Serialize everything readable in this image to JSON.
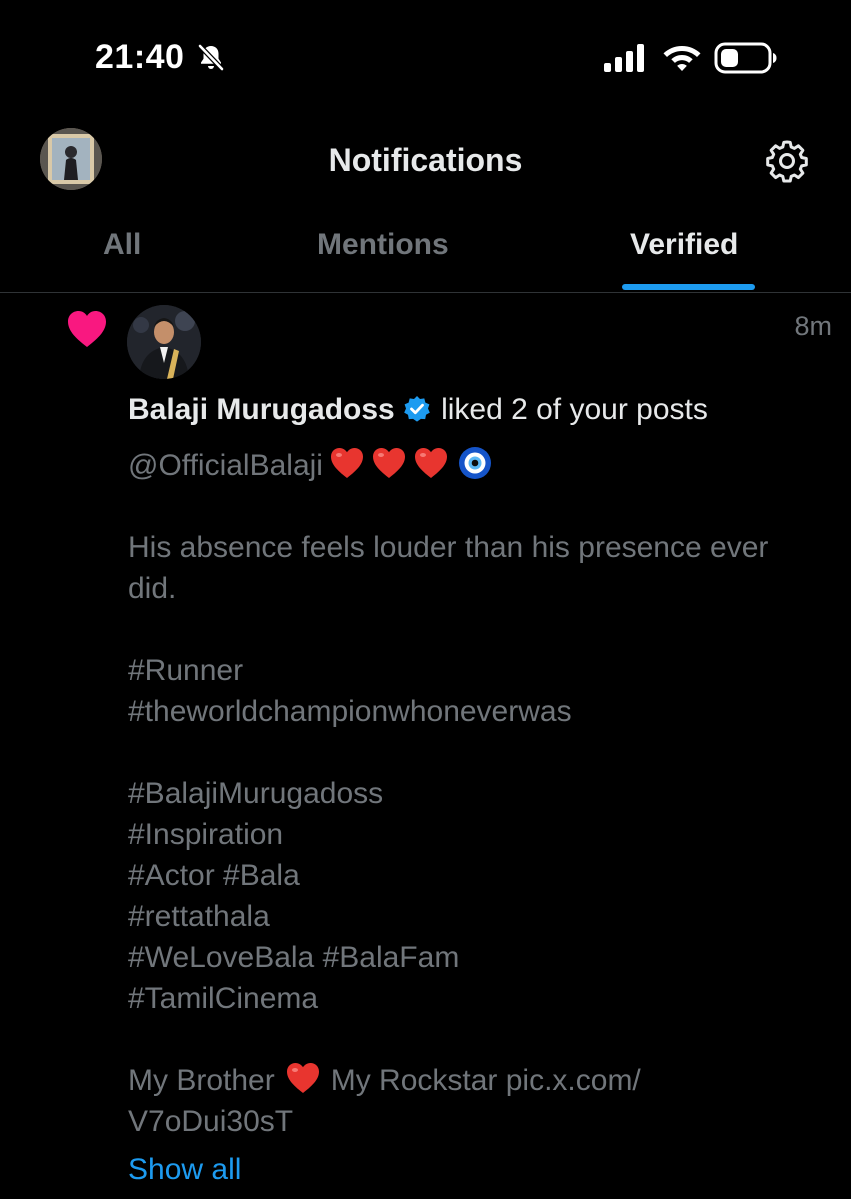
{
  "status_bar": {
    "time": "21:40",
    "icons": [
      "bell-slash-icon",
      "signal-icon",
      "wifi-icon",
      "battery-icon"
    ]
  },
  "header": {
    "title": "Notifications",
    "avatar": "profile-avatar",
    "settings_icon": "gear-icon"
  },
  "tabs": [
    {
      "label": "All",
      "active": false
    },
    {
      "label": "Mentions",
      "active": false
    },
    {
      "label": "Verified",
      "active": true
    }
  ],
  "notification": {
    "type_icon": "heart-icon",
    "time_ago": "8m",
    "user_name": "Balaji Murugadoss",
    "verified": true,
    "action": "liked 2 of your posts",
    "post_lines": [
      "@OfficialBalaji",
      "",
      "His absence feels louder than his presence ever",
      "did.",
      "",
      "#Runner",
      "#theworldchampionwhoneverwas",
      "",
      "#BalajiMurugadoss",
      "#Inspiration",
      "#Actor #Bala",
      "#rettathala",
      "#WeLoveBala #BalaFam",
      "#TamilCinema",
      "",
      "My Brother",
      "V7oDui30sT"
    ],
    "my_rockstar_text": "My Rockstar pic.x.com/",
    "show_all_label": "Show all"
  },
  "colors": {
    "background": "#000000",
    "text_primary": "#e7e9ea",
    "text_secondary": "#71767b",
    "accent": "#1d9bf0",
    "like": "#f91880"
  }
}
